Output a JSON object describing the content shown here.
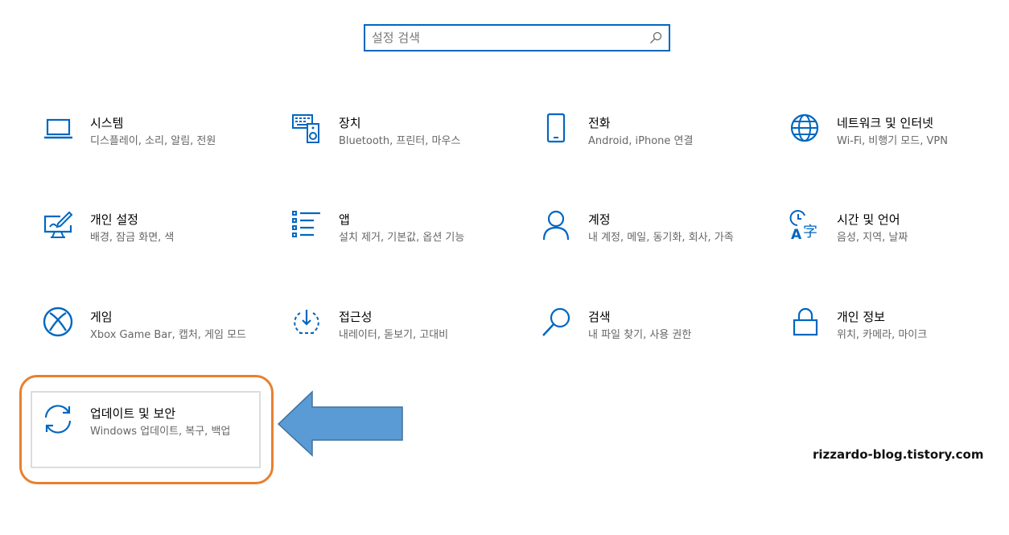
{
  "search": {
    "placeholder": "설정 검색",
    "value": ""
  },
  "tiles": [
    {
      "title": "시스템",
      "subtitle": "디스플레이, 소리, 알림, 전원",
      "icon": "laptop-icon"
    },
    {
      "title": "장치",
      "subtitle": "Bluetooth, 프린터, 마우스",
      "icon": "devices-icon"
    },
    {
      "title": "전화",
      "subtitle": "Android, iPhone 연결",
      "icon": "phone-icon"
    },
    {
      "title": "네트워크 및 인터넷",
      "subtitle": "Wi-Fi, 비행기 모드, VPN",
      "icon": "globe-icon"
    },
    {
      "title": "개인 설정",
      "subtitle": "배경, 잠금 화면, 색",
      "icon": "personalization-icon"
    },
    {
      "title": "앱",
      "subtitle": "설치 제거, 기본값, 옵션 기능",
      "icon": "apps-list-icon"
    },
    {
      "title": "계정",
      "subtitle": "내 계정, 메일, 동기화, 회사, 가족",
      "icon": "person-icon"
    },
    {
      "title": "시간 및 언어",
      "subtitle": "음성, 지역, 날짜",
      "icon": "time-language-icon"
    },
    {
      "title": "게임",
      "subtitle": "Xbox Game Bar, 캡처, 게임 모드",
      "icon": "xbox-icon"
    },
    {
      "title": "접근성",
      "subtitle": "내레이터, 돋보기, 고대비",
      "icon": "accessibility-icon"
    },
    {
      "title": "검색",
      "subtitle": "내 파일 찾기, 사용 권한",
      "icon": "search-icon"
    },
    {
      "title": "개인 정보",
      "subtitle": "위치, 카메라, 마이크",
      "icon": "lock-icon"
    },
    {
      "title": "업데이트 및 보안",
      "subtitle": "Windows 업데이트, 복구, 백업",
      "icon": "sync-icon"
    }
  ],
  "watermark": "rizzardo-blog.tistory.com",
  "colors": {
    "accent": "#0067c0",
    "highlight": "#e8802f",
    "arrow": "#5b9bd5"
  }
}
